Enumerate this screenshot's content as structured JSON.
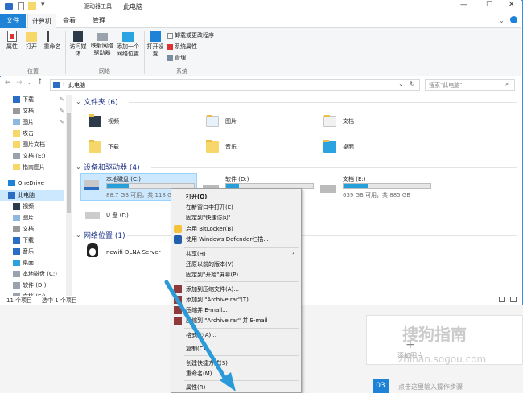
{
  "window": {
    "title": "此电脑",
    "context_tab_header": "驱动器工具",
    "controls": {
      "minimize": "—",
      "maximize": "☐",
      "close": "✕"
    }
  },
  "tabs": {
    "file": "文件",
    "computer": "计算机",
    "view": "查看",
    "manage": "管理"
  },
  "ribbon": {
    "location": {
      "properties": "属性",
      "open": "打开",
      "rename": "重命名",
      "label": "位置"
    },
    "network": {
      "access_media": "访问媒体",
      "map_drive": "映射网络驱动器",
      "add_location": "添加一个网络位置",
      "label": "网络"
    },
    "system": {
      "open_settings": "打开设置",
      "uninstall": "卸载或更改程序",
      "system_props": "系统属性",
      "manage": "管理",
      "label": "系统"
    }
  },
  "address": {
    "path": "此电脑",
    "search_placeholder": "搜索\"此电脑\""
  },
  "nav": {
    "items": [
      {
        "label": "下载",
        "pinned": true
      },
      {
        "label": "文档",
        "pinned": true
      },
      {
        "label": "图片",
        "pinned": true
      },
      {
        "label": "攻击"
      },
      {
        "label": "图片文档"
      },
      {
        "label": "文档 (E:)"
      },
      {
        "label": "指南图片"
      },
      {
        "label": "OneDrive"
      },
      {
        "label": "此电脑"
      },
      {
        "label": "视频"
      },
      {
        "label": "图片"
      },
      {
        "label": "文档"
      },
      {
        "label": "下载"
      },
      {
        "label": "音乐"
      },
      {
        "label": "桌面"
      },
      {
        "label": "本地磁盘 (C:)"
      },
      {
        "label": "软件 (D:)"
      },
      {
        "label": "文档 (E:)"
      }
    ]
  },
  "main": {
    "folders_header": "文件夹 (6)",
    "folders": [
      "视频",
      "图片",
      "文档",
      "下载",
      "音乐",
      "桌面"
    ],
    "drives_header": "设备和驱动器 (4)",
    "drives": [
      {
        "name": "本地磁盘 (C:)",
        "free": "88.7 GB 可用，共 118 GB",
        "used_fraction": 0.25
      },
      {
        "name": "软件 (D:)",
        "free": "",
        "used_fraction": 0.15
      },
      {
        "name": "文档 (E:)",
        "free": "639 GB 可用，共 885 GB",
        "used_fraction": 0.28
      },
      {
        "name": "U 盘 (F:)",
        "free": "",
        "used_fraction": 0
      }
    ],
    "network_header": "网络位置 (1)",
    "network_items": [
      "newifi DLNA Server"
    ]
  },
  "status": {
    "count": "11 个项目",
    "selected": "选中 1 个项目"
  },
  "context_menu": {
    "open": "打开(O)",
    "new_window": "在新窗口中打开(E)",
    "pin_quick": "固定到\"快速访问\"",
    "bitlocker": "启用 BitLocker(B)",
    "defender": "使用 Windows Defender扫描...",
    "share": "共享(H)",
    "restore": "还原以前的版本(V)",
    "pin_start": "固定到\"开始\"屏幕(P)",
    "add_archive": "添加到压缩文件(A)...",
    "add_rar": "添加到 \"Archive.rar\"(T)",
    "compress_email": "压缩并 E-mail...",
    "compress_rar_email": "压缩到 \"Archive.rar\" 并 E-mail",
    "format": "格式化(A)...",
    "copy": "复制(C)",
    "shortcut": "创建快捷方式(S)",
    "rename": "重命名(M)",
    "properties": "属性(R)"
  },
  "background": {
    "add_image": "添加图片",
    "step_number": "03",
    "step_hint": "点击这里输入操作步骤"
  },
  "watermark": {
    "main": "搜狗指南",
    "url": "zhinan.sogou.com"
  },
  "colors": {
    "accent": "#1e83d6",
    "drive_fill": "#26a0da",
    "context_tab": "#f6e7a7",
    "selection": "#cce8ff",
    "arrow": "#2a9ad8"
  }
}
